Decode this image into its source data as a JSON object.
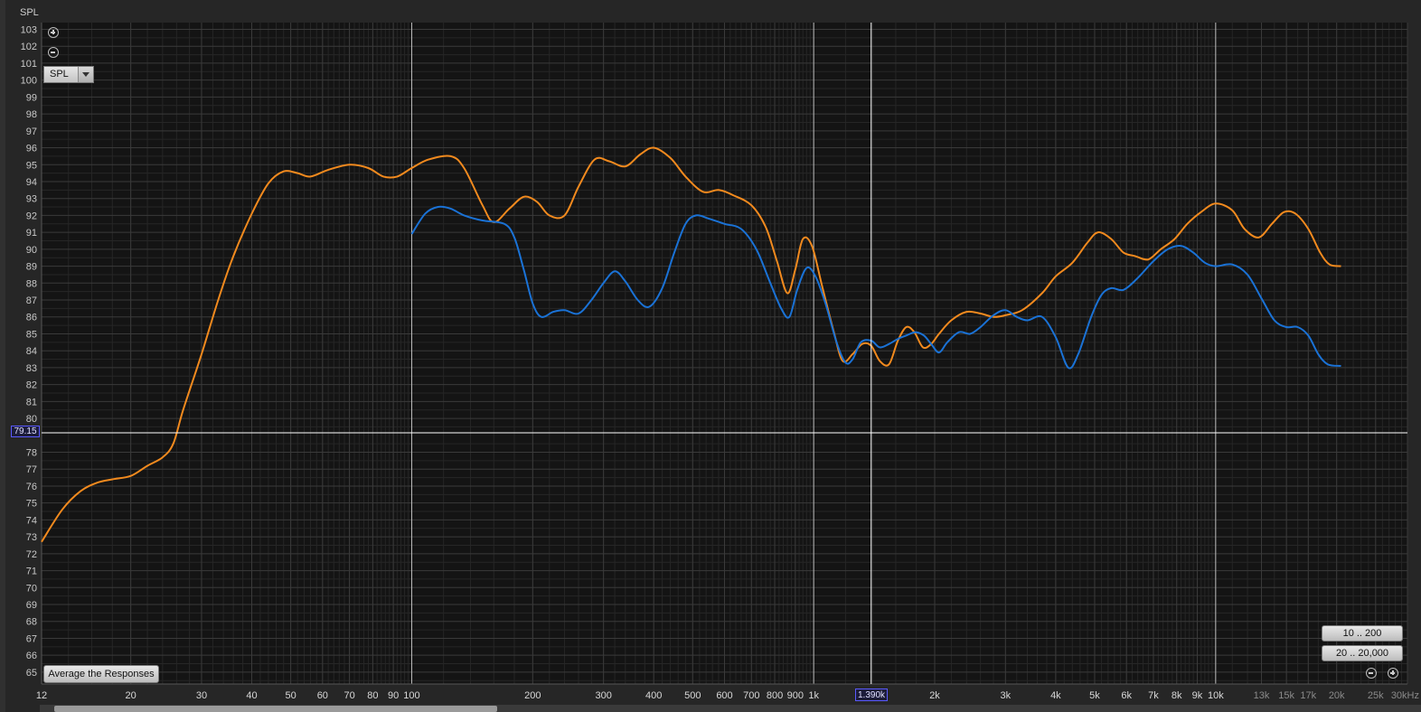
{
  "app": {
    "y_axis_title": "SPL",
    "spl_selector": "SPL",
    "average_button": "Average the Responses",
    "range_buttons": [
      "10 .. 200",
      "20 .. 20,000"
    ],
    "cursor_y": "79.15",
    "cursor_x": "1.390k",
    "colors": {
      "background": "#141414",
      "grid": "#3a3a3a",
      "orange": "#f28a1e",
      "blue": "#1a72d6",
      "cursor": "#ffffff"
    }
  },
  "chart_data": {
    "type": "line",
    "title": "",
    "xlabel": "",
    "ylabel": "SPL",
    "x_scale": "log",
    "xlim": [
      12,
      30000
    ],
    "ylim": [
      64.3,
      103.4
    ],
    "grid": true,
    "y_ticks": [
      65,
      66,
      67,
      68,
      69,
      70,
      71,
      72,
      73,
      74,
      75,
      76,
      77,
      78,
      80,
      81,
      82,
      83,
      84,
      85,
      86,
      87,
      88,
      89,
      90,
      91,
      92,
      93,
      94,
      95,
      96,
      97,
      98,
      99,
      100,
      101,
      102,
      103
    ],
    "x_ticks": [
      {
        "v": 12,
        "label": "12"
      },
      {
        "v": 20,
        "label": "20"
      },
      {
        "v": 30,
        "label": "30"
      },
      {
        "v": 40,
        "label": "40"
      },
      {
        "v": 50,
        "label": "50"
      },
      {
        "v": 60,
        "label": "60"
      },
      {
        "v": 70,
        "label": "70"
      },
      {
        "v": 80,
        "label": "80"
      },
      {
        "v": 90,
        "label": "90"
      },
      {
        "v": 100,
        "label": "100"
      },
      {
        "v": 200,
        "label": "200"
      },
      {
        "v": 300,
        "label": "300"
      },
      {
        "v": 400,
        "label": "400"
      },
      {
        "v": 500,
        "label": "500"
      },
      {
        "v": 600,
        "label": "600"
      },
      {
        "v": 700,
        "label": "700"
      },
      {
        "v": 800,
        "label": "800"
      },
      {
        "v": 900,
        "label": "900"
      },
      {
        "v": 1000,
        "label": "1k"
      },
      {
        "v": 2000,
        "label": "2k"
      },
      {
        "v": 3000,
        "label": "3k"
      },
      {
        "v": 4000,
        "label": "4k"
      },
      {
        "v": 5000,
        "label": "5k"
      },
      {
        "v": 6000,
        "label": "6k"
      },
      {
        "v": 7000,
        "label": "7k"
      },
      {
        "v": 8000,
        "label": "8k"
      },
      {
        "v": 9000,
        "label": "9k"
      },
      {
        "v": 10000,
        "label": "10k"
      },
      {
        "v": 13000,
        "label": "13k"
      },
      {
        "v": 15000,
        "label": "15k"
      },
      {
        "v": 17000,
        "label": "17k"
      },
      {
        "v": 20000,
        "label": "20k"
      },
      {
        "v": 25000,
        "label": "25k"
      },
      {
        "v": 30000,
        "label": "30kHz"
      }
    ],
    "cursor": {
      "x": 1390,
      "y": 79.15
    },
    "series": [
      {
        "color": "#f28a1e",
        "points": [
          [
            12,
            72.7
          ],
          [
            13.5,
            74.6
          ],
          [
            15,
            75.7
          ],
          [
            16.5,
            76.2
          ],
          [
            18,
            76.4
          ],
          [
            20,
            76.6
          ],
          [
            22,
            77.2
          ],
          [
            24,
            77.7
          ],
          [
            25.5,
            78.5
          ],
          [
            27,
            80.5
          ],
          [
            30,
            83.8
          ],
          [
            33,
            87.0
          ],
          [
            36,
            89.6
          ],
          [
            40,
            92.1
          ],
          [
            44,
            93.9
          ],
          [
            48,
            94.6
          ],
          [
            52,
            94.5
          ],
          [
            56,
            94.3
          ],
          [
            62,
            94.7
          ],
          [
            70,
            95.0
          ],
          [
            78,
            94.8
          ],
          [
            85,
            94.3
          ],
          [
            92,
            94.3
          ],
          [
            100,
            94.8
          ],
          [
            110,
            95.3
          ],
          [
            125,
            95.5
          ],
          [
            135,
            94.8
          ],
          [
            150,
            92.6
          ],
          [
            160,
            91.6
          ],
          [
            175,
            92.4
          ],
          [
            190,
            93.1
          ],
          [
            205,
            92.8
          ],
          [
            220,
            92.0
          ],
          [
            240,
            92.0
          ],
          [
            260,
            93.7
          ],
          [
            285,
            95.3
          ],
          [
            310,
            95.2
          ],
          [
            340,
            94.9
          ],
          [
            370,
            95.6
          ],
          [
            400,
            96.0
          ],
          [
            440,
            95.4
          ],
          [
            480,
            94.3
          ],
          [
            530,
            93.4
          ],
          [
            580,
            93.5
          ],
          [
            630,
            93.2
          ],
          [
            700,
            92.6
          ],
          [
            760,
            91.3
          ],
          [
            810,
            89.3
          ],
          [
            860,
            87.4
          ],
          [
            900,
            88.8
          ],
          [
            940,
            90.6
          ],
          [
            990,
            90.2
          ],
          [
            1050,
            87.8
          ],
          [
            1120,
            85.2
          ],
          [
            1180,
            83.4
          ],
          [
            1250,
            83.8
          ],
          [
            1320,
            84.4
          ],
          [
            1390,
            84.3
          ],
          [
            1460,
            83.4
          ],
          [
            1540,
            83.2
          ],
          [
            1620,
            84.6
          ],
          [
            1700,
            85.4
          ],
          [
            1780,
            85.1
          ],
          [
            1870,
            84.2
          ],
          [
            1960,
            84.4
          ],
          [
            2050,
            85.0
          ],
          [
            2200,
            85.8
          ],
          [
            2400,
            86.3
          ],
          [
            2600,
            86.2
          ],
          [
            2800,
            86.0
          ],
          [
            3000,
            86.1
          ],
          [
            3300,
            86.4
          ],
          [
            3700,
            87.4
          ],
          [
            4000,
            88.4
          ],
          [
            4400,
            89.2
          ],
          [
            4800,
            90.4
          ],
          [
            5100,
            91.0
          ],
          [
            5500,
            90.6
          ],
          [
            5900,
            89.8
          ],
          [
            6300,
            89.6
          ],
          [
            6800,
            89.4
          ],
          [
            7300,
            90.0
          ],
          [
            7900,
            90.6
          ],
          [
            8500,
            91.5
          ],
          [
            9200,
            92.2
          ],
          [
            10000,
            92.7
          ],
          [
            11000,
            92.3
          ],
          [
            11800,
            91.2
          ],
          [
            12800,
            90.7
          ],
          [
            13800,
            91.5
          ],
          [
            14800,
            92.2
          ],
          [
            15800,
            92.1
          ],
          [
            17000,
            91.2
          ],
          [
            18200,
            89.8
          ],
          [
            19200,
            89.1
          ],
          [
            20500,
            89.0
          ]
        ]
      },
      {
        "color": "#1a72d6",
        "points": [
          [
            100,
            90.9
          ],
          [
            108,
            92.1
          ],
          [
            116,
            92.5
          ],
          [
            125,
            92.4
          ],
          [
            135,
            92.0
          ],
          [
            150,
            91.7
          ],
          [
            170,
            91.5
          ],
          [
            180,
            90.7
          ],
          [
            190,
            88.8
          ],
          [
            200,
            86.8
          ],
          [
            210,
            86.0
          ],
          [
            225,
            86.3
          ],
          [
            240,
            86.4
          ],
          [
            260,
            86.2
          ],
          [
            280,
            87.0
          ],
          [
            300,
            88.0
          ],
          [
            320,
            88.7
          ],
          [
            340,
            88.1
          ],
          [
            365,
            87.0
          ],
          [
            390,
            86.6
          ],
          [
            420,
            87.7
          ],
          [
            450,
            89.8
          ],
          [
            480,
            91.5
          ],
          [
            510,
            92.0
          ],
          [
            550,
            91.8
          ],
          [
            600,
            91.5
          ],
          [
            660,
            91.2
          ],
          [
            720,
            90.0
          ],
          [
            780,
            88.0
          ],
          [
            830,
            86.5
          ],
          [
            870,
            86.0
          ],
          [
            910,
            87.6
          ],
          [
            960,
            88.9
          ],
          [
            1010,
            88.4
          ],
          [
            1070,
            86.8
          ],
          [
            1140,
            84.5
          ],
          [
            1200,
            83.3
          ],
          [
            1250,
            83.5
          ],
          [
            1310,
            84.5
          ],
          [
            1390,
            84.6
          ],
          [
            1460,
            84.2
          ],
          [
            1540,
            84.4
          ],
          [
            1620,
            84.7
          ],
          [
            1700,
            84.9
          ],
          [
            1790,
            85.1
          ],
          [
            1880,
            84.9
          ],
          [
            1960,
            84.4
          ],
          [
            2050,
            83.9
          ],
          [
            2150,
            84.5
          ],
          [
            2300,
            85.1
          ],
          [
            2450,
            85.0
          ],
          [
            2600,
            85.4
          ],
          [
            2800,
            86.1
          ],
          [
            3000,
            86.4
          ],
          [
            3200,
            86.0
          ],
          [
            3400,
            85.8
          ],
          [
            3700,
            86.0
          ],
          [
            4000,
            84.8
          ],
          [
            4300,
            83.0
          ],
          [
            4550,
            83.8
          ],
          [
            4900,
            86.0
          ],
          [
            5200,
            87.3
          ],
          [
            5500,
            87.7
          ],
          [
            5900,
            87.6
          ],
          [
            6400,
            88.3
          ],
          [
            7000,
            89.3
          ],
          [
            7600,
            90.0
          ],
          [
            8200,
            90.2
          ],
          [
            8800,
            89.8
          ],
          [
            9400,
            89.2
          ],
          [
            10000,
            89.0
          ],
          [
            11000,
            89.1
          ],
          [
            12000,
            88.5
          ],
          [
            13000,
            87.1
          ],
          [
            14000,
            85.8
          ],
          [
            15000,
            85.4
          ],
          [
            16000,
            85.4
          ],
          [
            17000,
            84.9
          ],
          [
            18000,
            83.8
          ],
          [
            19000,
            83.2
          ],
          [
            20500,
            83.1
          ]
        ]
      }
    ]
  }
}
